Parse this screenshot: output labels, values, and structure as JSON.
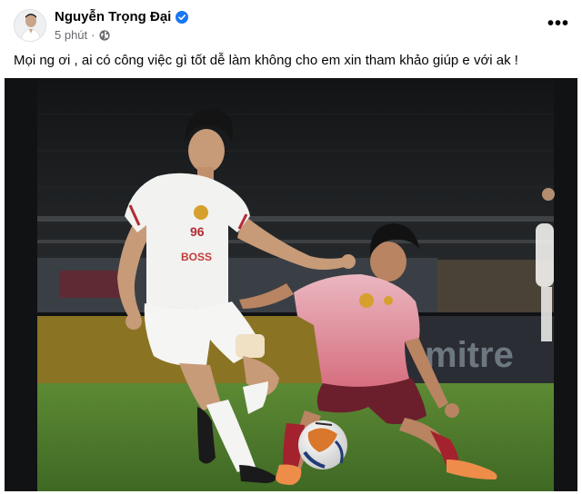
{
  "post": {
    "author_name": "Nguyễn Trọng Đại",
    "timestamp": "5 phút",
    "text": "Mọi ng ơi , ai có công việc gì tốt dễ làm không cho em xin tham khảo giúp e với ak !",
    "more_label": "•••"
  },
  "photo": {
    "jersey_number": "96",
    "jersey_sponsor": "BOSS",
    "board_text": "mitre",
    "colors": {
      "pitch": "#4f7a2e",
      "stands": "#1b1d1f",
      "white_kit": "#f2f2f0",
      "pink_kit": "#e6a3b0",
      "maroon_shorts": "#6b1e2c"
    }
  },
  "icons": {
    "verified": "verified-badge-icon",
    "audience": "globe-icon",
    "more": "more-options-icon"
  }
}
